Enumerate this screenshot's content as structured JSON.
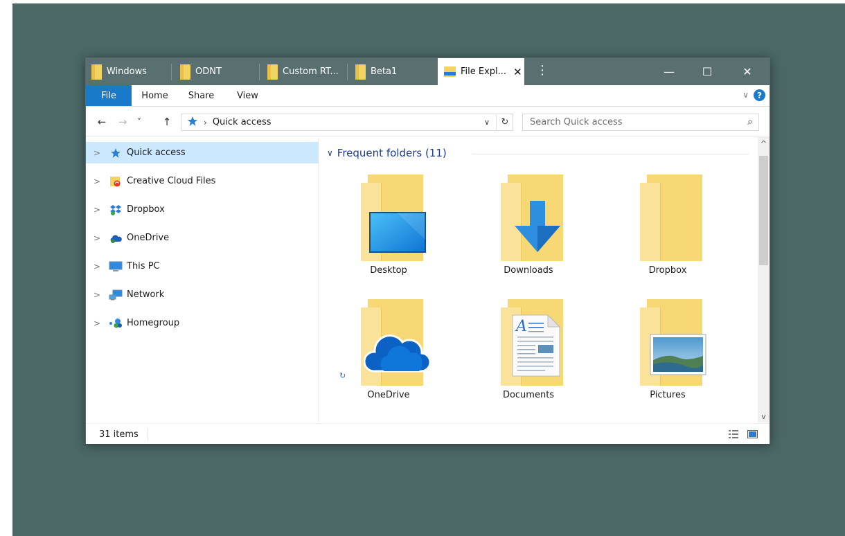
{
  "tabs": [
    {
      "label": "Windows",
      "icon": "folder-icon"
    },
    {
      "label": "ODNT",
      "icon": "folder-icon"
    },
    {
      "label": "Custom RT...",
      "icon": "folder-icon"
    },
    {
      "label": "Beta1",
      "icon": "folder-icon"
    },
    {
      "label": "File Expl...",
      "icon": "file-explorer-icon",
      "active": true
    }
  ],
  "window_controls": {
    "minimize": "—",
    "maximize": "☐",
    "close": "✕",
    "tab_close": "✕",
    "tab_menu": "⋮"
  },
  "ribbon": {
    "tabs": [
      "File",
      "Home",
      "Share",
      "View"
    ],
    "expand": "∨",
    "help": "?"
  },
  "address_bar": {
    "back": "←",
    "forward": "→",
    "recent": "˅",
    "up": "↑",
    "separator": "›",
    "path": "Quick access",
    "dropdown": "∨",
    "refresh": "↻"
  },
  "search": {
    "placeholder": "Search Quick access",
    "value": "",
    "icon": "⌕"
  },
  "sidebar": {
    "items": [
      {
        "label": "Quick access",
        "icon": "quick-access-star-icon",
        "selected": true
      },
      {
        "label": "Creative Cloud Files",
        "icon": "creative-cloud-icon"
      },
      {
        "label": "Dropbox",
        "icon": "dropbox-icon"
      },
      {
        "label": "OneDrive",
        "icon": "onedrive-icon"
      },
      {
        "label": "This PC",
        "icon": "this-pc-icon"
      },
      {
        "label": "Network",
        "icon": "network-icon"
      },
      {
        "label": "Homegroup",
        "icon": "homegroup-icon"
      }
    ],
    "chevron": ">"
  },
  "content": {
    "group_header": "Frequent folders (11)",
    "group_chevron": "∨",
    "folders": [
      {
        "label": "Desktop",
        "overlay": "desktop-monitor-icon"
      },
      {
        "label": "Downloads",
        "overlay": "download-arrow-icon"
      },
      {
        "label": "Dropbox",
        "overlay": "none"
      },
      {
        "label": "OneDrive",
        "overlay": "onedrive-cloud-icon"
      },
      {
        "label": "Documents",
        "overlay": "document-page-icon"
      },
      {
        "label": "Pictures",
        "overlay": "picture-landscape-icon"
      }
    ],
    "sync_glyph": "↻"
  },
  "scrollbar": {
    "up": "^",
    "down": "v"
  },
  "status_bar": {
    "count": "31 items"
  },
  "colors": {
    "accent": "#1979ca",
    "tabbar": "#5a6f6f",
    "desktop": "#4b6866",
    "selection": "#cce8ff",
    "folder": "#f8d775",
    "header_text": "#1e3c8c"
  }
}
